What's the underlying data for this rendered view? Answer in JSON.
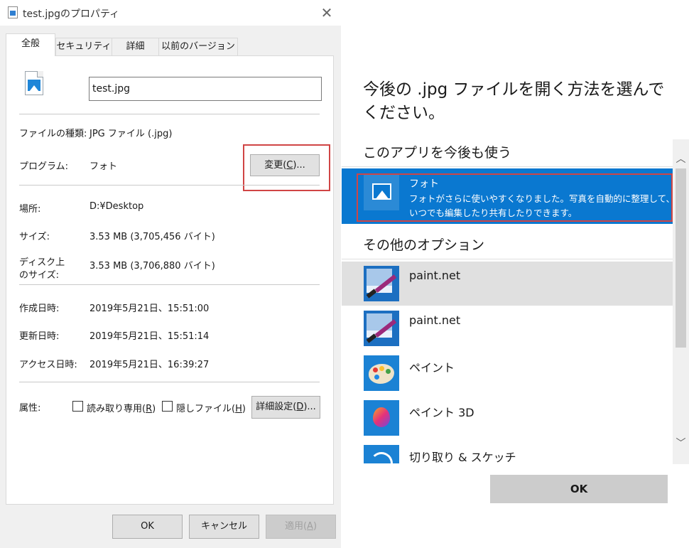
{
  "properties": {
    "window_title": "test.jpgのプロパティ",
    "close_glyph": "✕",
    "tabs": [
      "全般",
      "セキュリティ",
      "詳細",
      "以前のバージョン"
    ],
    "filename": "test.jpg",
    "file_type_label": "ファイルの種類:",
    "file_type_value": "JPG ファイル (.jpg)",
    "program_label": "プログラム:",
    "program_value": "フォト",
    "change_button": {
      "prefix": "変更(",
      "key": "C",
      "suffix": ")..."
    },
    "location_label": "場所:",
    "location_value": "D:¥Desktop",
    "size_label": "サイズ:",
    "size_value": "3.53 MB (3,705,456 バイト)",
    "disk_size_label_line1": "ディスク上",
    "disk_size_label_line2": "のサイズ:",
    "disk_size_value": "3.53 MB (3,706,880 バイト)",
    "created_label": "作成日時:",
    "created_value": "2019年5月21日、15:51:00",
    "modified_label": "更新日時:",
    "modified_value": "2019年5月21日、15:51:14",
    "accessed_label": "アクセス日時:",
    "accessed_value": "2019年5月21日、16:39:27",
    "attributes_label": "属性:",
    "readonly": {
      "prefix": "読み取り専用(",
      "key": "R",
      "suffix": ")",
      "checked": false
    },
    "hidden": {
      "prefix": "隠しファイル(",
      "key": "H",
      "suffix": ")",
      "checked": false
    },
    "advanced_button": {
      "prefix": "詳細設定(",
      "key": "D",
      "suffix": ")..."
    },
    "ok_button": "OK",
    "cancel_button": "キャンセル",
    "apply_button": {
      "prefix": "適用(",
      "key": "A",
      "suffix": ")"
    }
  },
  "open_with": {
    "title": "今後の .jpg ファイルを開く方法を選んでください。",
    "keep_using_heading": "このアプリを今後も使う",
    "selected_app": {
      "name": "フォト",
      "description": "フォトがさらに使いやすくなりました。写真を自動的に整理して、いつでも編集したり共有したりできます。"
    },
    "other_options_heading": "その他のオプション",
    "apps": [
      {
        "name": "paint.net",
        "icon": "paint-net-icon"
      },
      {
        "name": "paint.net",
        "icon": "paint-net-icon"
      },
      {
        "name": "ペイント",
        "icon": "paint-palette-icon"
      },
      {
        "name": "ペイント 3D",
        "icon": "paint-3d-icon"
      },
      {
        "name": "切り取り & スケッチ",
        "icon": "snip-sketch-icon"
      }
    ],
    "scroll_up_glyph": "︿",
    "scroll_down_glyph": "﹀",
    "ok_button": "OK"
  },
  "colors": {
    "accent": "#0a78d0",
    "highlight_box": "#d04545"
  }
}
